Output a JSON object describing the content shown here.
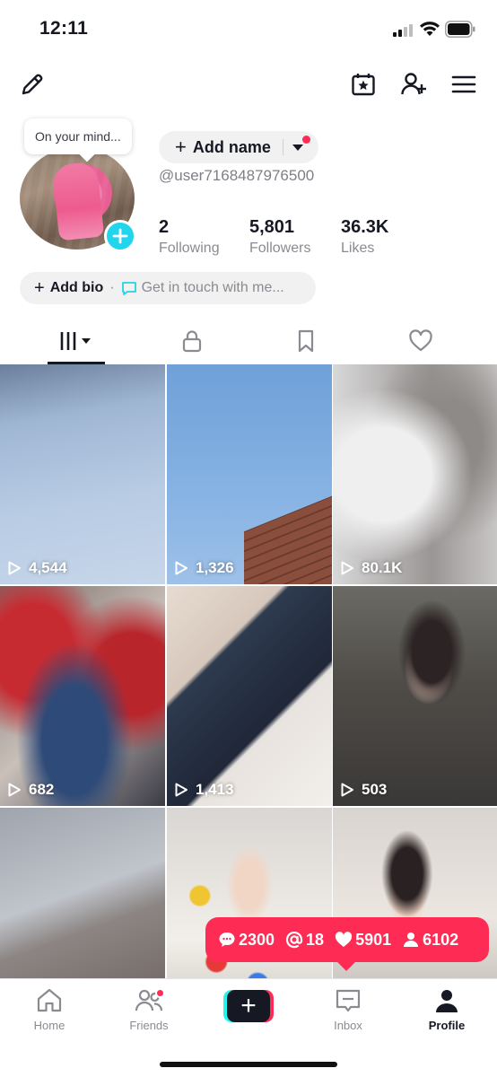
{
  "status_bar": {
    "time": "12:11"
  },
  "profile": {
    "mind_bubble": "On your mind...",
    "add_name_label": "Add name",
    "username": "@user7168487976500",
    "stats": [
      {
        "value": "2",
        "label": "Following"
      },
      {
        "value": "5,801",
        "label": "Followers"
      },
      {
        "value": "36.3K",
        "label": "Likes"
      }
    ],
    "add_bio_label": "Add bio",
    "bio_separator": "·",
    "get_in_touch_label": "Get in touch with me..."
  },
  "tabs": [
    "videos-grid",
    "private-lock",
    "saved-bookmark",
    "liked-heart"
  ],
  "videos": [
    {
      "views": "4,544"
    },
    {
      "views": "1,326"
    },
    {
      "views": "80.1K"
    },
    {
      "views": "682"
    },
    {
      "views": "1,413"
    },
    {
      "views": "503"
    },
    {
      "views": ""
    },
    {
      "views": ""
    },
    {
      "views": ""
    }
  ],
  "notification": {
    "comments": "2300",
    "mentions": "18",
    "likes": "5901",
    "followers": "6102"
  },
  "bottom_nav": {
    "home": "Home",
    "friends": "Friends",
    "inbox": "Inbox",
    "profile": "Profile"
  },
  "colors": {
    "accent": "#fe2c55",
    "cyan": "#20d5ec",
    "text": "#161823",
    "muted": "#8a8b91"
  }
}
